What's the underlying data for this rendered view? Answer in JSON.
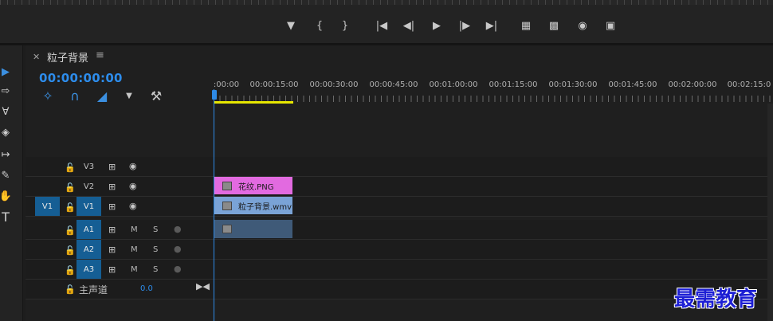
{
  "sequence": {
    "tab_title": "粒子背景",
    "timecode": "00:00:00:00"
  },
  "ruler": {
    "labels": [
      ":00:00",
      "00:00:15:00",
      "00:00:30:00",
      "00:00:45:00",
      "00:01:00:00",
      "00:01:15:00",
      "00:01:30:00",
      "00:01:45:00",
      "00:02:00:00",
      "00:02:15:0"
    ]
  },
  "tracks": {
    "video": [
      {
        "name": "V3",
        "source_patch": ""
      },
      {
        "name": "V2",
        "source_patch": ""
      },
      {
        "name": "V1",
        "source_patch": "V1"
      }
    ],
    "audio": [
      {
        "name": "A1",
        "mute": "M",
        "solo": "S"
      },
      {
        "name": "A2",
        "mute": "M",
        "solo": "S"
      },
      {
        "name": "A3",
        "mute": "M",
        "solo": "S"
      }
    ],
    "master": {
      "label": "主声道",
      "value": "0.0"
    }
  },
  "clips": {
    "v2": "花纹.PNG",
    "v1": "粒子背景.wmv"
  },
  "watermark": "最需教育",
  "colors": {
    "accent": "#2d8ceb",
    "track_target": "#155e94",
    "clip_v2": "#e26ae0",
    "clip_v1": "#7aa3d6",
    "clip_audio": "#3f5a78",
    "work_area": "#e6e600"
  }
}
